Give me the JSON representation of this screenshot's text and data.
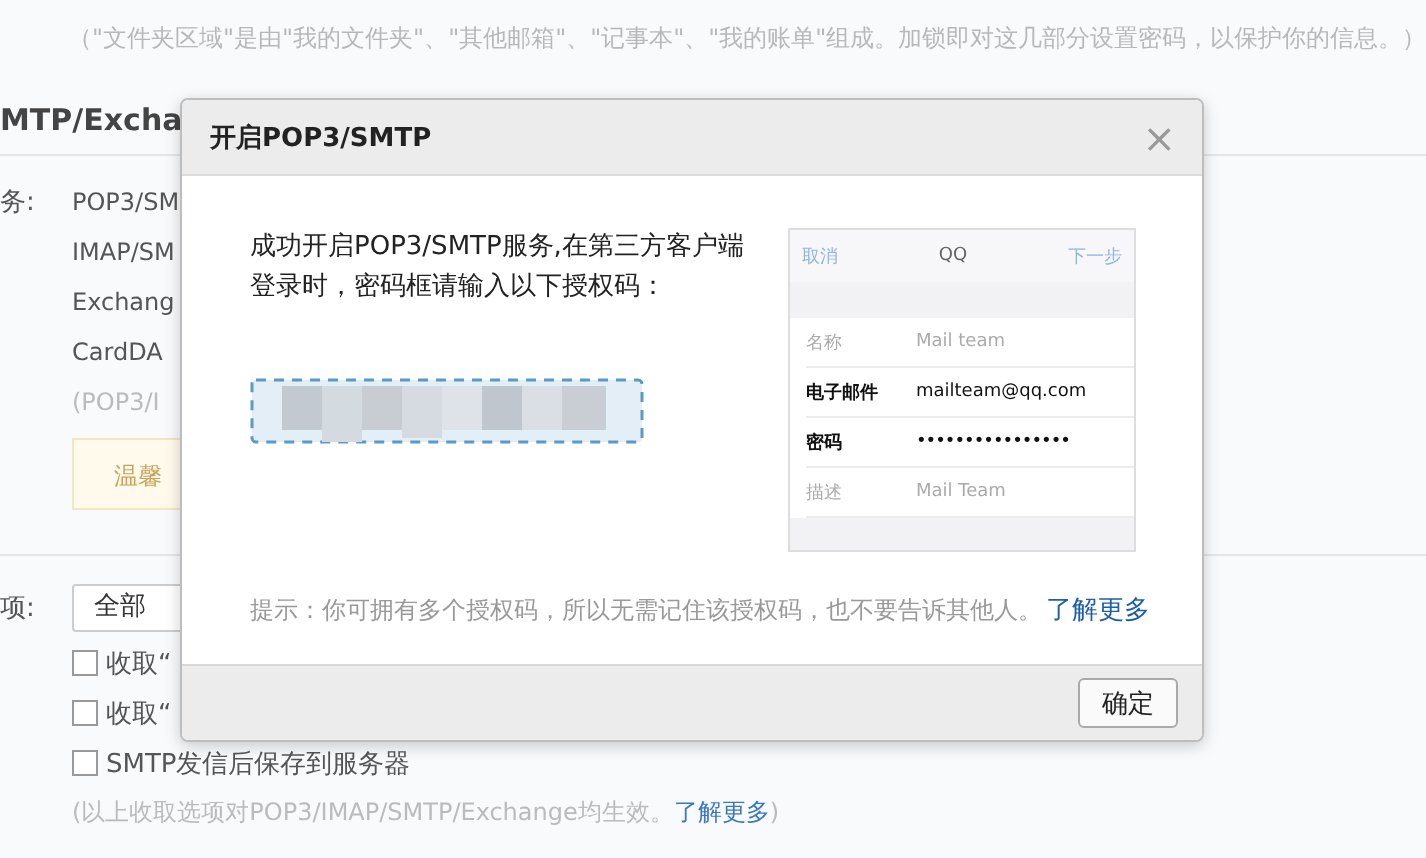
{
  "page": {
    "folder_note": "（\"文件夹区域\"是由\"我的文件夹\"、\"其他邮箱\"、\"记事本\"、\"我的账单\"组成。加锁即对这几部分设置密码，以保护你的信息。）",
    "section_title": "MTP/Excha",
    "services_label": "务:",
    "services": [
      "POP3/SM",
      "IMAP/SM",
      "Exchang",
      "CardDA"
    ],
    "services_note": "(POP3/I",
    "tip": "温馨",
    "receive_label": "项:",
    "receive_select": "全部",
    "options": [
      {
        "label": "收取“",
        "checked": false
      },
      {
        "label": "收取“",
        "checked": false
      },
      {
        "label": "SMTP发信后保存到服务器",
        "checked": false
      }
    ],
    "options_note": "(以上收取选项对POP3/IMAP/SMTP/Exchange均生效。",
    "options_note_link": "了解更多",
    "options_note_end": ")"
  },
  "dialog": {
    "title": "开启POP3/SMTP",
    "close": "×",
    "message": "成功开启POP3/SMTP服务,在第三方客户端登录时，密码框请输入以下授权码：",
    "preview": {
      "cancel": "取消",
      "title": "QQ",
      "next": "下一步",
      "rows": [
        {
          "label": "名称",
          "placeholder": "Mail team"
        },
        {
          "label": "电子邮件",
          "value": "mailteam@qq.com"
        },
        {
          "label": "密码",
          "value": "••••••••••••••••"
        },
        {
          "label": "描述",
          "placeholder": "Mail Team"
        }
      ]
    },
    "hint": "提示：你可拥有多个授权码，所以无需记住该授权码，也不要告诉其他人。",
    "hint_link": "了解更多",
    "ok": "确定"
  }
}
